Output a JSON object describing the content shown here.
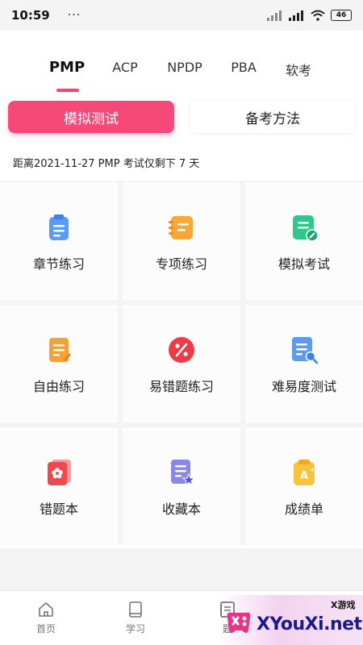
{
  "status_bar": {
    "time": "10:59",
    "dots": "···",
    "battery": "46"
  },
  "cert_tabs": [
    "PMP",
    "ACP",
    "NPDP",
    "PBA",
    "软考"
  ],
  "mode_buttons": {
    "mock_test": "模拟测试",
    "prep_method": "备考方法"
  },
  "countdown": "距离2021-11-27 PMP 考试仅剩下 7 天",
  "tiles": [
    {
      "label": "章节练习",
      "icon": "chapter-clipboard-icon",
      "color": "#5b9bf2"
    },
    {
      "label": "专项练习",
      "icon": "notebook-icon",
      "color": "#f8a83a"
    },
    {
      "label": "模拟考试",
      "icon": "exam-edit-icon",
      "color": "#2ec98a"
    },
    {
      "label": "自由练习",
      "icon": "document-pen-icon",
      "color": "#f5a13a"
    },
    {
      "label": "易错题练习",
      "icon": "percent-icon",
      "color": "#ee3b45"
    },
    {
      "label": "难易度测试",
      "icon": "document-search-icon",
      "color": "#5b9bf2"
    },
    {
      "label": "错题本",
      "icon": "flower-book-icon",
      "color": "#ee4a4e"
    },
    {
      "label": "收藏本",
      "icon": "star-document-icon",
      "color": "#8b87e6"
    },
    {
      "label": "成绩单",
      "icon": "grade-clipboard-icon",
      "color": "#f7c23c"
    }
  ],
  "bottom_nav": [
    {
      "label": "首页",
      "icon": "home-icon"
    },
    {
      "label": "学习",
      "icon": "book-icon"
    },
    {
      "label": "题",
      "icon": "question-bank-icon"
    }
  ],
  "watermark": {
    "small": "X游戏",
    "main": "XYouXi.net"
  },
  "accent_color": "#f6497a"
}
